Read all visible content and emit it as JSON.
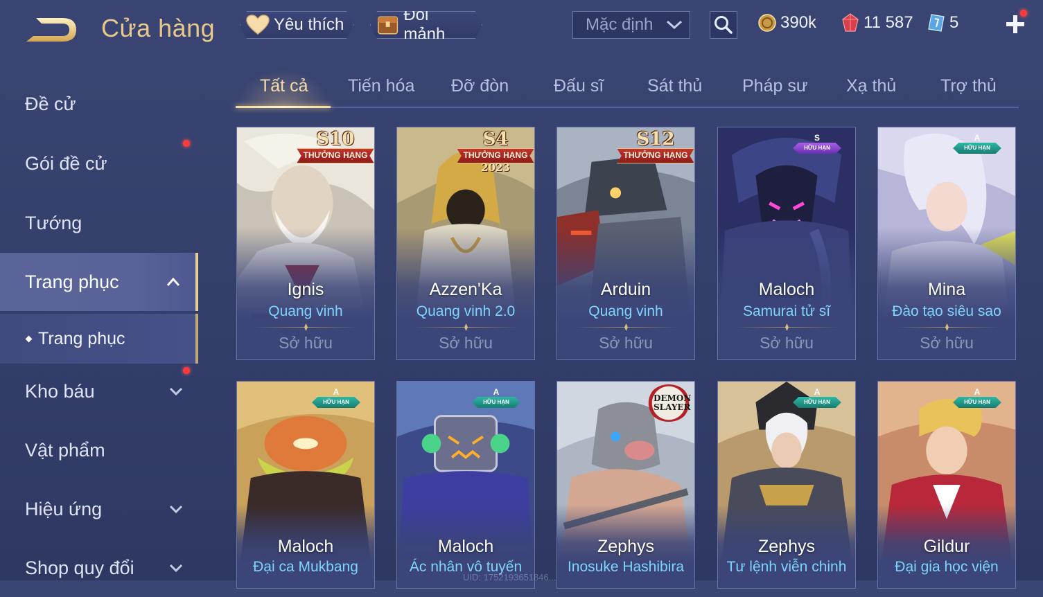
{
  "header": {
    "title": "Cửa hàng",
    "favorites_label": "Yêu thích",
    "exchange_label": "Đổi mảnh",
    "sort_value": "Mặc định",
    "currencies": {
      "gold": "390k",
      "ruby": "11 587",
      "voucher": "5"
    }
  },
  "sidebar": {
    "items": [
      {
        "label": "Đề cử"
      },
      {
        "label": "Gói đề cử",
        "notification": true
      },
      {
        "label": "Tướng"
      },
      {
        "label": "Trang phục",
        "expanded": true,
        "active": true
      },
      {
        "label": "Kho báu",
        "notification": true
      },
      {
        "label": "Vật phẩm"
      },
      {
        "label": "Hiệu ứng"
      },
      {
        "label": "Shop quy đổi"
      }
    ],
    "sub_item": {
      "label": "Trang phục"
    }
  },
  "tabs": [
    {
      "label": "Tất cả",
      "active": true
    },
    {
      "label": "Tiến hóa"
    },
    {
      "label": "Đỡ đòn"
    },
    {
      "label": "Đấu sĩ"
    },
    {
      "label": "Sát thủ"
    },
    {
      "label": "Pháp sư"
    },
    {
      "label": "Xạ thủ"
    },
    {
      "label": "Trợ thủ"
    }
  ],
  "cards": [
    {
      "hero": "Ignis",
      "skin": "Quang vinh",
      "status": "Sở hữu",
      "badge_rank": "S10",
      "badge_ribbon": "THƯỞNG HẠNG"
    },
    {
      "hero": "Azzen'Ka",
      "skin": "Quang vinh 2.0",
      "status": "Sở hữu",
      "badge_rank": "S4",
      "badge_ribbon": "THƯỞNG HẠNG",
      "badge_year": "2023"
    },
    {
      "hero": "Arduin",
      "skin": "Quang vinh",
      "status": "Sở hữu",
      "badge_rank": "S12",
      "badge_ribbon": "THƯỞNG HẠNG"
    },
    {
      "hero": "Maloch",
      "skin": "Samurai tử sĩ",
      "status": "Sở hữu",
      "tier": "S",
      "tier_label": "HỮU HẠN"
    },
    {
      "hero": "Mina",
      "skin": "Đào tạo siêu sao",
      "status": "Sở hữu",
      "tier": "A",
      "tier_label": "HỮU HẠN"
    },
    {
      "hero": "Maloch",
      "skin": "Đại ca Mukbang",
      "tier": "A",
      "tier_label": "HỮU HẠN"
    },
    {
      "hero": "Maloch",
      "skin": "Ác nhân vô tuyến",
      "tier": "A",
      "tier_label": "HỮU HẠN"
    },
    {
      "hero": "Zephys",
      "skin": "Inosuke Hashibira",
      "collab_logo": "DEMON SLAYER"
    },
    {
      "hero": "Zephys",
      "skin": "Tư lệnh viễn chinh",
      "tier": "A",
      "tier_label": "HỮU HẠN"
    },
    {
      "hero": "Gildur",
      "skin": "Đại gia học viện",
      "tier": "A",
      "tier_label": "HỮU HẠN"
    }
  ],
  "footer_uid": "UID: 1752193651846...",
  "colors": {
    "accent_gold": "#e9c98a",
    "skin_name": "#7fd4ff",
    "notification": "#ff3b3b"
  }
}
